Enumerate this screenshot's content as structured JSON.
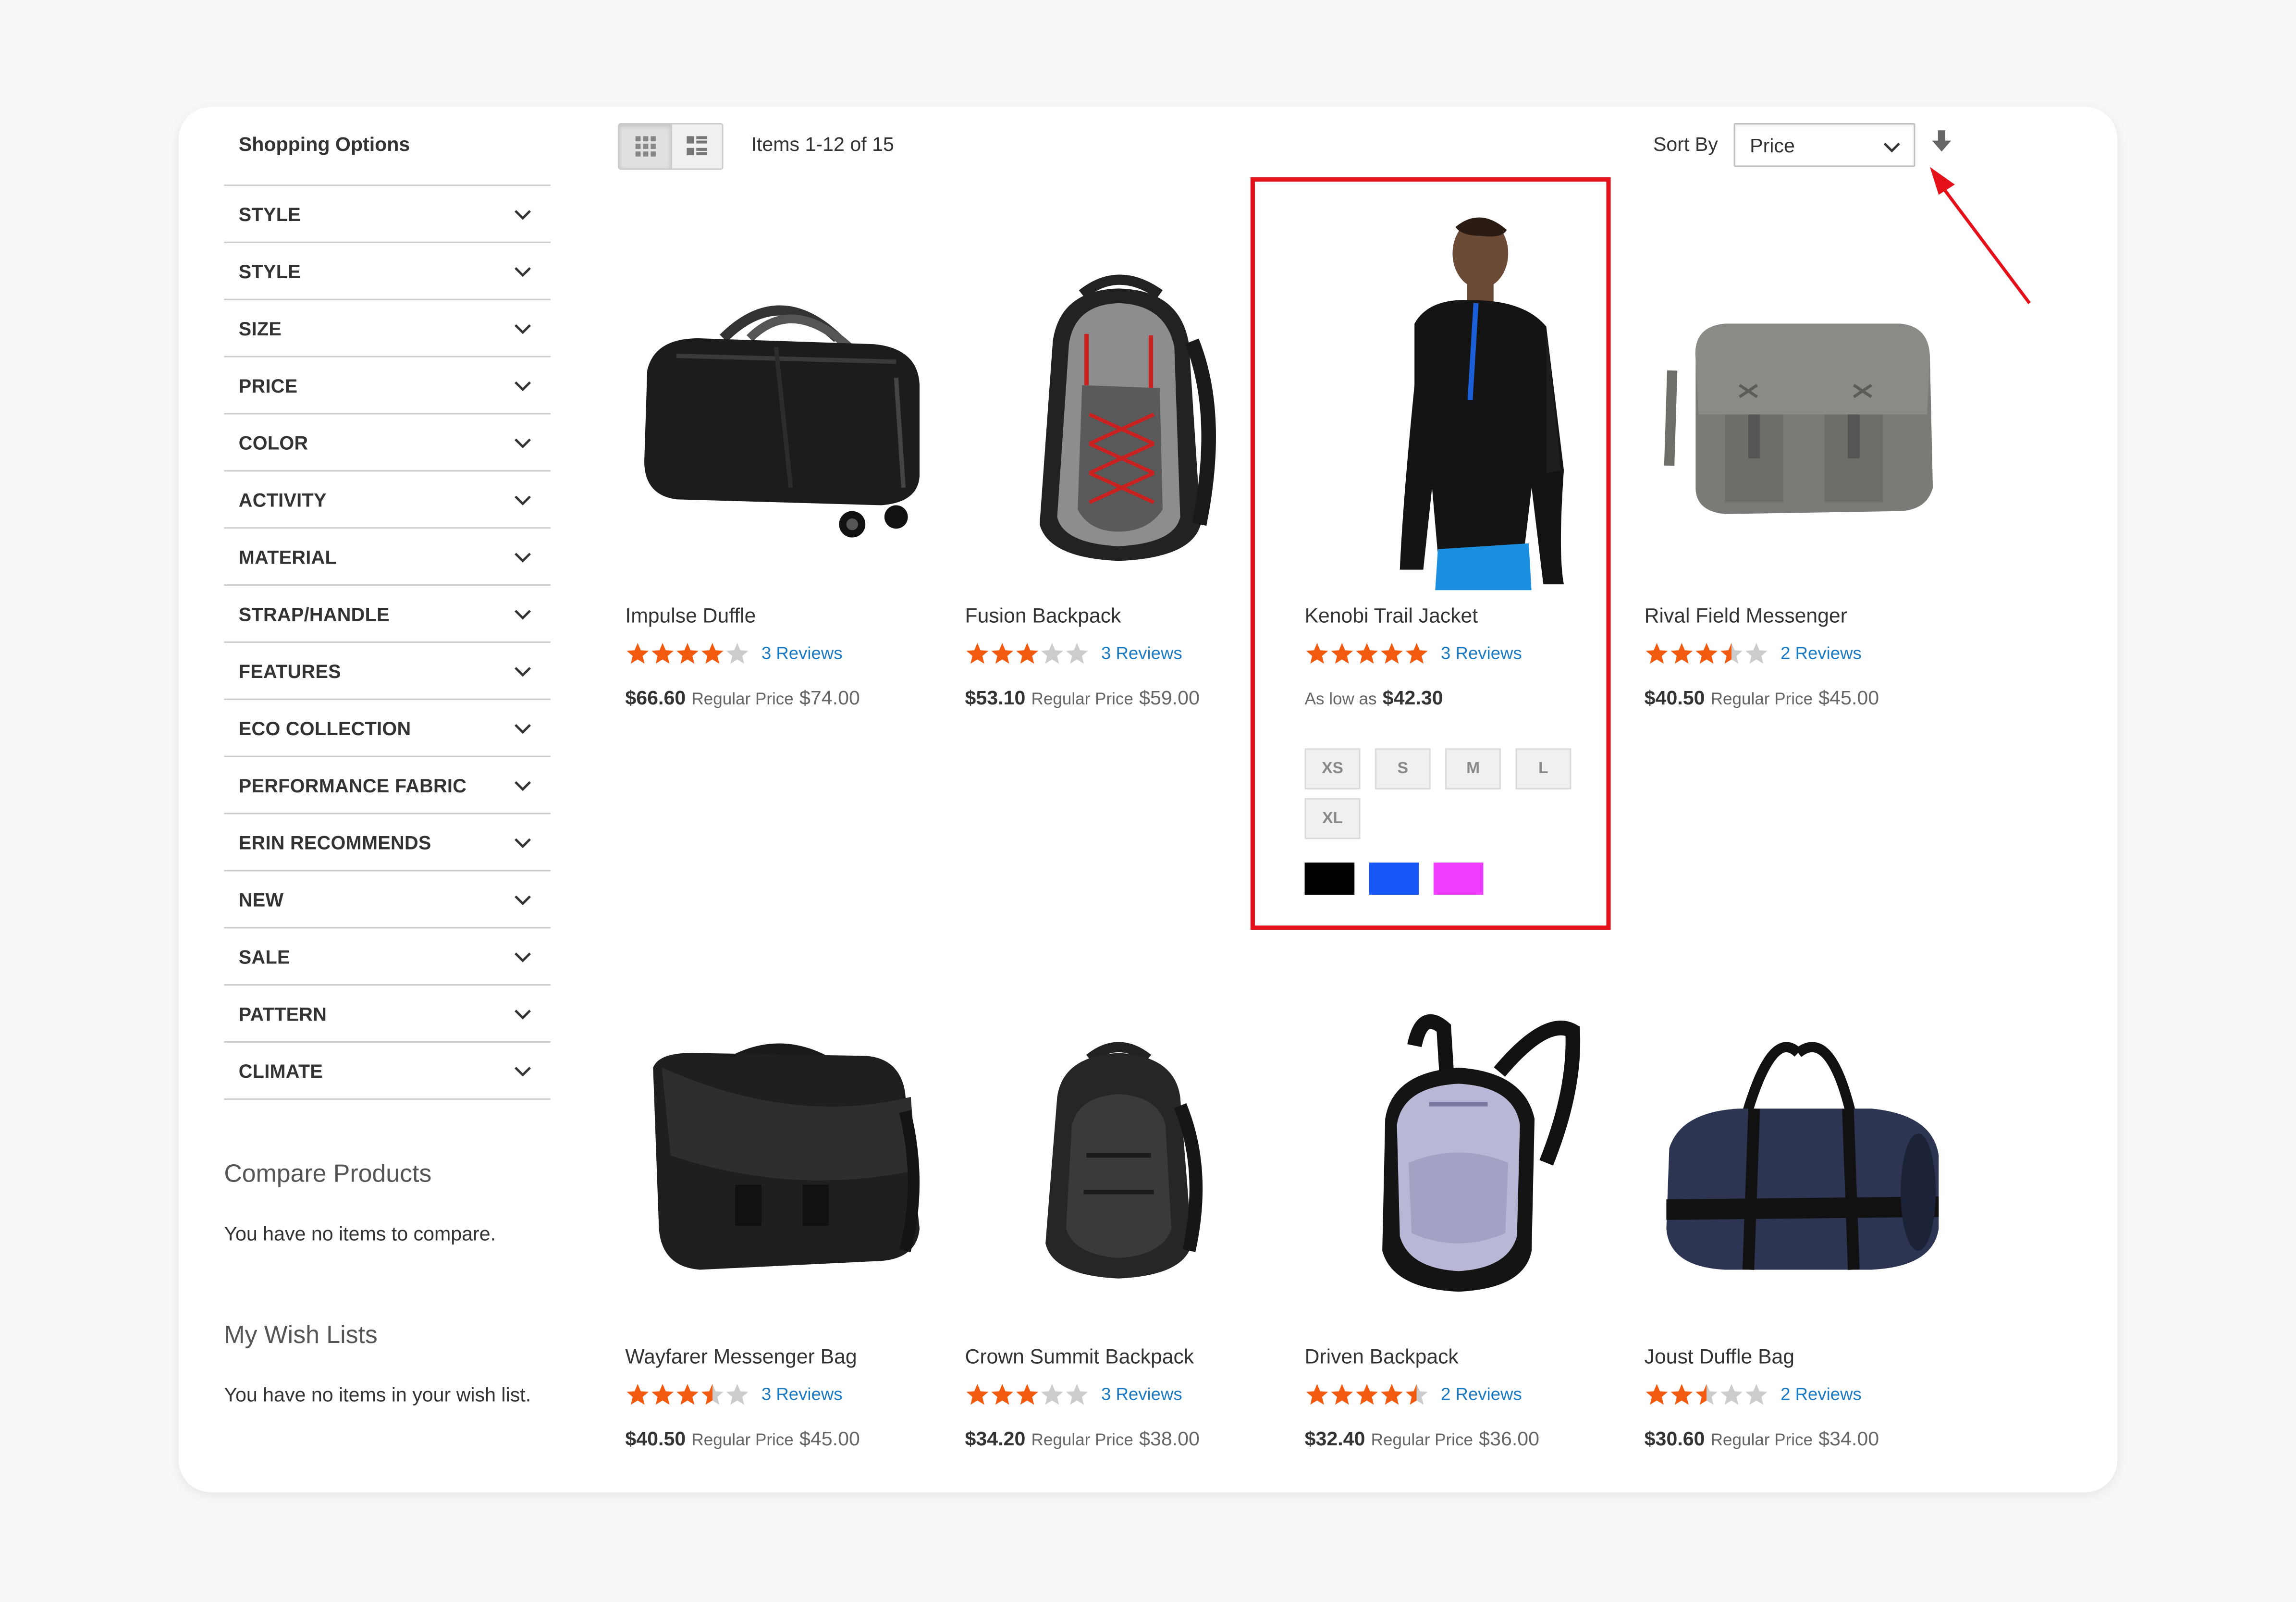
{
  "sidebar": {
    "title": "Shopping Options",
    "filters": [
      "STYLE",
      "STYLE",
      "SIZE",
      "PRICE",
      "COLOR",
      "ACTIVITY",
      "MATERIAL",
      "STRAP/HANDLE",
      "FEATURES",
      "ECO COLLECTION",
      "PERFORMANCE FABRIC",
      "ERIN RECOMMENDS",
      "NEW",
      "SALE",
      "PATTERN",
      "CLIMATE"
    ],
    "compare": {
      "heading": "Compare Products",
      "text": "You have no items to compare."
    },
    "wishlist": {
      "heading": "My Wish Lists",
      "text": "You have no items in your wish list."
    }
  },
  "toolbar": {
    "view_modes": [
      {
        "icon": "grid-icon",
        "active": true
      },
      {
        "icon": "list-icon",
        "active": false
      }
    ],
    "items_count": "Items 1-12 of 15",
    "sort_label": "Sort By",
    "sort_value": "Price",
    "sort_direction_icon": "arrow-down-icon"
  },
  "annotation": {
    "color": "#e4111b",
    "highlighted_product": "Kenobi Trail Jacket"
  },
  "products": [
    {
      "name": "Impulse Duffle",
      "rating": 4,
      "reviews": "3  Reviews",
      "price": "$66.60",
      "regular_label": "Regular Price",
      "regular_price": "$74.00",
      "image_icon": "duffle-bag-image"
    },
    {
      "name": "Fusion Backpack",
      "rating": 3,
      "reviews": "3  Reviews",
      "price": "$53.10",
      "regular_label": "Regular Price",
      "regular_price": "$59.00",
      "image_icon": "backpack-image"
    },
    {
      "name": "Kenobi Trail Jacket",
      "rating": 5,
      "reviews": "3  Reviews",
      "as_low_label": "As low as",
      "price": "$42.30",
      "sizes": [
        "XS",
        "S",
        "M",
        "L",
        "XL"
      ],
      "colors": [
        "#000000",
        "#1857f7",
        "#ef3dff"
      ],
      "image_icon": "jacket-model-image"
    },
    {
      "name": "Rival Field Messenger",
      "rating": 3.5,
      "reviews": "2  Reviews",
      "price": "$40.50",
      "regular_label": "Regular Price",
      "regular_price": "$45.00",
      "image_icon": "messenger-bag-image"
    },
    {
      "name": "Wayfarer Messenger Bag",
      "rating": 3.5,
      "reviews": "3  Reviews",
      "price": "$40.50",
      "regular_label": "Regular Price",
      "regular_price": "$45.00",
      "image_icon": "messenger-bag-image"
    },
    {
      "name": "Crown Summit Backpack",
      "rating": 3,
      "reviews": "3  Reviews",
      "price": "$34.20",
      "regular_label": "Regular Price",
      "regular_price": "$38.00",
      "image_icon": "backpack-image"
    },
    {
      "name": "Driven Backpack",
      "rating": 4.5,
      "reviews": "2  Reviews",
      "price": "$32.40",
      "regular_label": "Regular Price",
      "regular_price": "$36.00",
      "image_icon": "backpack-image"
    },
    {
      "name": "Joust Duffle Bag",
      "rating": 2.5,
      "reviews": "2  Reviews",
      "price": "$30.60",
      "regular_label": "Regular Price",
      "regular_price": "$34.00",
      "image_icon": "duffle-bag-image"
    }
  ],
  "colors": {
    "star": "#f25a0f",
    "star_empty": "#cccccc",
    "link": "#1979c3"
  }
}
